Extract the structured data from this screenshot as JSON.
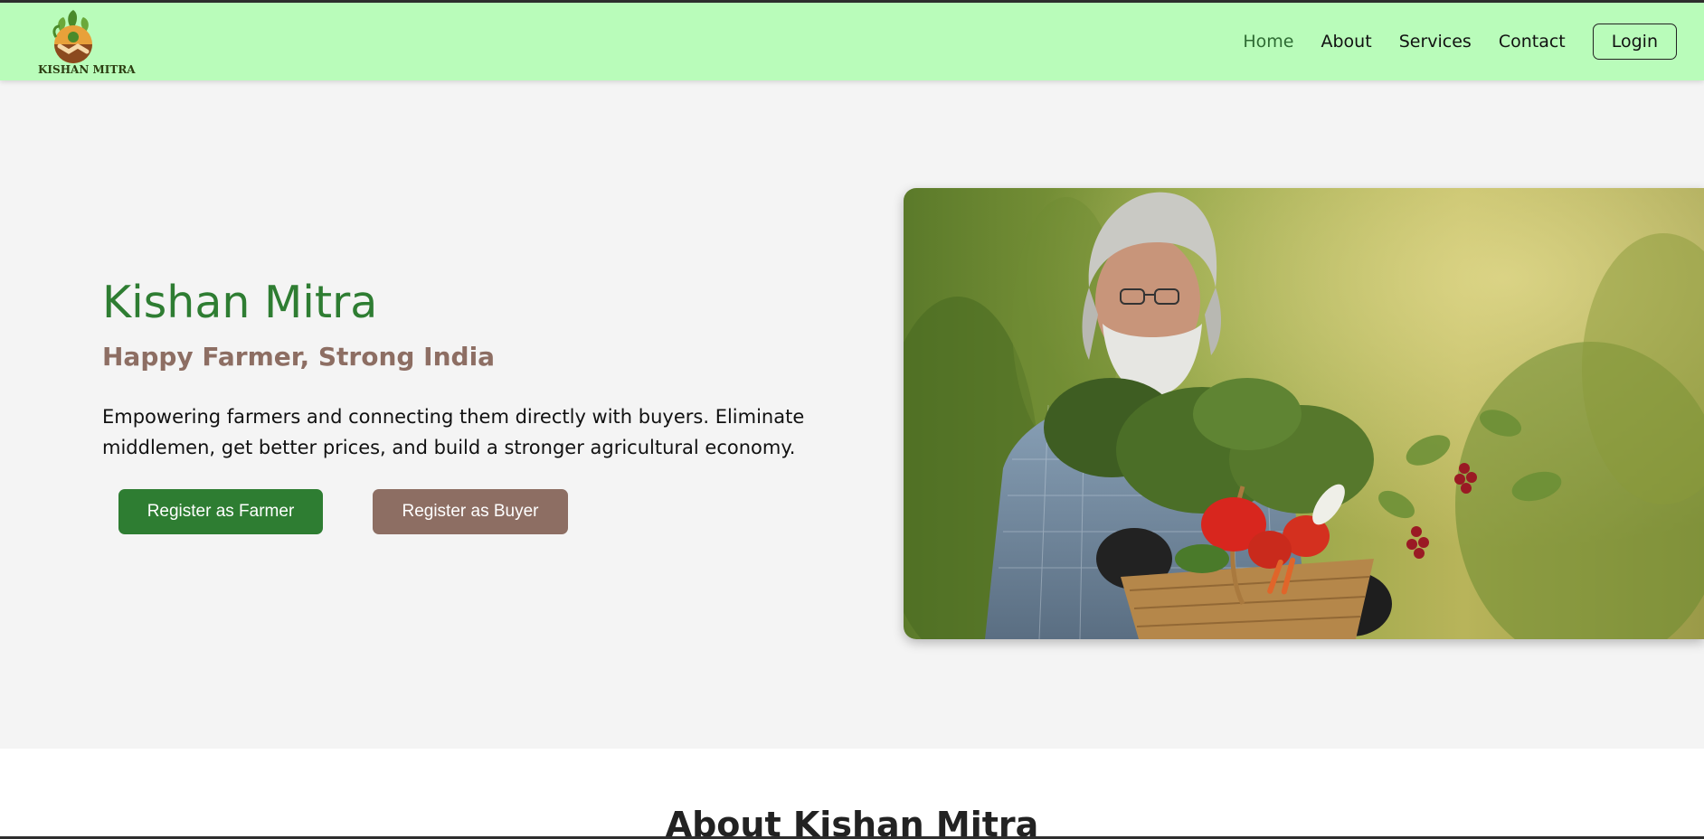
{
  "brand": {
    "logo_text": "KISHAN MITRA"
  },
  "nav": {
    "links": [
      {
        "label": "Home",
        "active": true
      },
      {
        "label": "About",
        "active": false
      },
      {
        "label": "Services",
        "active": false
      },
      {
        "label": "Contact",
        "active": false
      }
    ],
    "login_label": "Login"
  },
  "hero": {
    "title": "Kishan Mitra",
    "subtitle": "Happy Farmer, Strong India",
    "description": "Empowering farmers and connecting them directly with buyers. Eliminate middlemen, get better prices, and build a stronger agricultural economy.",
    "register_farmer_label": "Register as Farmer",
    "register_buyer_label": "Register as Buyer"
  },
  "about": {
    "title": "About Kishan Mitra"
  },
  "colors": {
    "navbar_bg": "#b9fcba",
    "primary_green": "#2e7d32",
    "secondary_brown": "#8d6e63",
    "page_bg": "#f4f4f4"
  }
}
